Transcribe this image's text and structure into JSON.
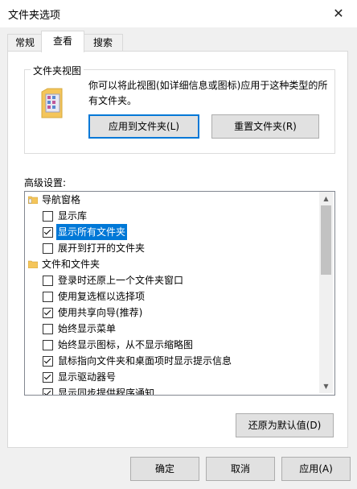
{
  "window": {
    "title": "文件夹选项"
  },
  "tabs": [
    {
      "label": "常规"
    },
    {
      "label": "查看"
    },
    {
      "label": "搜索"
    }
  ],
  "folder_views": {
    "group_label": "文件夹视图",
    "description": "你可以将此视图(如详细信息或图标)应用于这种类型的所有文件夹。",
    "apply_button": "应用到文件夹(L)",
    "reset_button": "重置文件夹(R)"
  },
  "advanced": {
    "label": "高级设置:",
    "items": [
      {
        "type": "folder",
        "label": "导航窗格"
      },
      {
        "type": "checkbox",
        "label": "显示库",
        "checked": false
      },
      {
        "type": "checkbox",
        "label": "显示所有文件夹",
        "checked": true,
        "selected": true
      },
      {
        "type": "checkbox",
        "label": "展开到打开的文件夹",
        "checked": false
      },
      {
        "type": "folder",
        "label": "文件和文件夹"
      },
      {
        "type": "checkbox",
        "label": "登录时还原上一个文件夹窗口",
        "checked": false
      },
      {
        "type": "checkbox",
        "label": "使用复选框以选择项",
        "checked": false
      },
      {
        "type": "checkbox",
        "label": "使用共享向导(推荐)",
        "checked": true
      },
      {
        "type": "checkbox",
        "label": "始终显示菜单",
        "checked": false
      },
      {
        "type": "checkbox",
        "label": "始终显示图标，从不显示缩略图",
        "checked": false
      },
      {
        "type": "checkbox",
        "label": "鼠标指向文件夹和桌面项时显示提示信息",
        "checked": true
      },
      {
        "type": "checkbox",
        "label": "显示驱动器号",
        "checked": true
      },
      {
        "type": "checkbox",
        "label": "显示同步提供程序通知",
        "checked": true
      }
    ],
    "restore_button": "还原为默认值(D)"
  },
  "footer": {
    "ok": "确定",
    "cancel": "取消",
    "apply": "应用(A)"
  }
}
